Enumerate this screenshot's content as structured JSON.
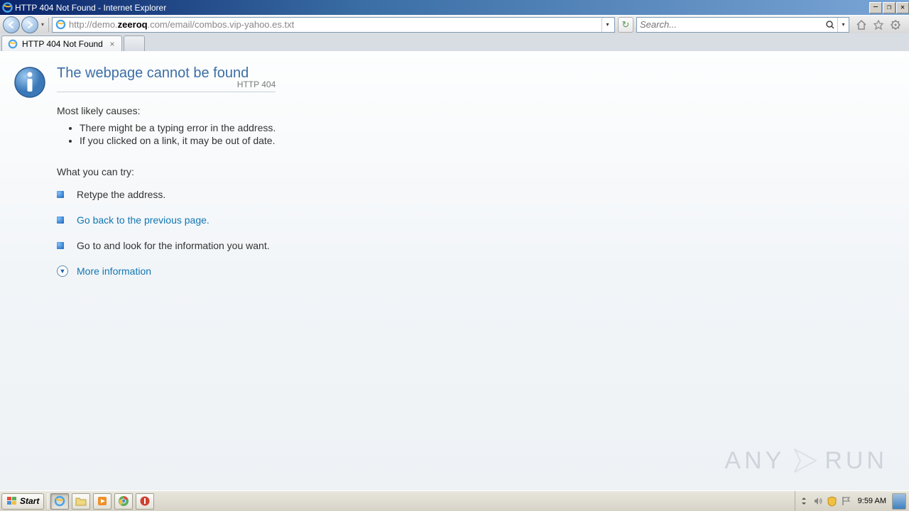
{
  "window": {
    "title": "HTTP 404 Not Found - Internet Explorer"
  },
  "addressbar": {
    "url_prefix": "http://demo.",
    "url_domain": "zeeroq",
    "url_suffix": ".com/email/combos.vip-yahoo.es.txt"
  },
  "search": {
    "placeholder": "Search..."
  },
  "tab": {
    "title": "HTTP 404 Not Found"
  },
  "error": {
    "heading": "The webpage cannot be found",
    "code": "HTTP 404",
    "causes_header": "Most likely causes:",
    "causes": [
      "There might be a typing error in the address.",
      "If you clicked on a link, it may be out of date."
    ],
    "try_header": "What you can try:",
    "suggestions": [
      {
        "text": "Retype the address.",
        "link": false
      },
      {
        "text": "Go back to the previous page.",
        "link": true
      },
      {
        "text": "Go to  and look for the information you want.",
        "link": false
      }
    ],
    "more_info": "More information"
  },
  "watermark": {
    "left": "ANY",
    "right": "RUN"
  },
  "taskbar": {
    "start": "Start",
    "clock": "9:59 AM"
  }
}
